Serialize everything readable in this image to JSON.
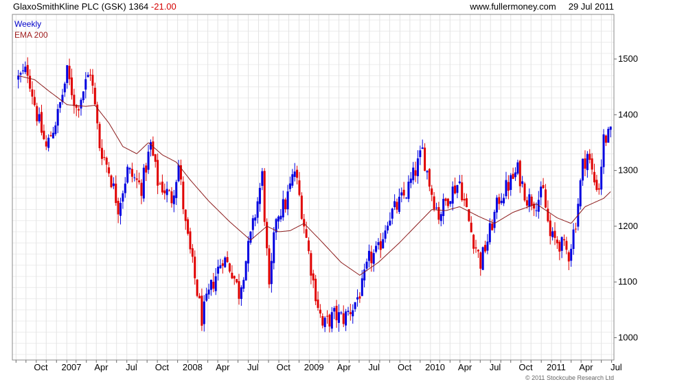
{
  "header": {
    "title": "GlaxoSmithKline PLC (GSK)",
    "last_price": "1364",
    "change": "-21.00",
    "website": "www.fullermoney.com",
    "date": "29 Jul 2011"
  },
  "legend": {
    "primary": "Weekly",
    "overlay": "EMA 200"
  },
  "footer": {
    "copyright": "© 2011 Stockcube Research Ltd"
  },
  "colors": {
    "up": "#0000e0",
    "down": "#e00000",
    "ema": "#8b1a1a",
    "grid": "#d9d9d9"
  },
  "chart_data": {
    "type": "candlestick",
    "interval": "weekly",
    "y_axis": {
      "position": "right",
      "ylim": [
        960,
        1580
      ],
      "ticks": [
        1000,
        1100,
        1200,
        1300,
        1400,
        1500
      ]
    },
    "x_axis": {
      "tick_labels": [
        "Oct",
        "2007",
        "Apr",
        "Jul",
        "Oct",
        "2008",
        "Apr",
        "Jul",
        "Oct",
        "2009",
        "Apr",
        "Jul",
        "Oct",
        "2010",
        "Apr",
        "Jul",
        "Oct",
        "2011",
        "Apr",
        "Jul"
      ]
    },
    "grid": true,
    "price_path": [
      [
        "2006-09-08",
        1465
      ],
      [
        "2006-10-06",
        1480
      ],
      [
        "2006-11-03",
        1400
      ],
      [
        "2006-12-01",
        1340
      ],
      [
        "2007-01-05",
        1400
      ],
      [
        "2007-02-02",
        1475
      ],
      [
        "2007-03-02",
        1410
      ],
      [
        "2007-04-13",
        1480
      ],
      [
        "2007-05-11",
        1345
      ],
      [
        "2007-06-08",
        1300
      ],
      [
        "2007-07-06",
        1235
      ],
      [
        "2007-08-03",
        1300
      ],
      [
        "2007-09-14",
        1270
      ],
      [
        "2007-10-12",
        1345
      ],
      [
        "2007-11-02",
        1280
      ],
      [
        "2007-12-14",
        1250
      ],
      [
        "2008-01-04",
        1310
      ],
      [
        "2008-01-25",
        1200
      ],
      [
        "2008-03-14",
        1035
      ],
      [
        "2008-04-11",
        1090
      ],
      [
        "2008-05-16",
        1145
      ],
      [
        "2008-06-13",
        1120
      ],
      [
        "2008-07-04",
        1080
      ],
      [
        "2008-08-15",
        1200
      ],
      [
        "2008-09-12",
        1290
      ],
      [
        "2008-10-03",
        1080
      ],
      [
        "2008-10-24",
        1220
      ],
      [
        "2008-11-21",
        1240
      ],
      [
        "2008-12-19",
        1300
      ],
      [
        "2009-01-09",
        1230
      ],
      [
        "2009-02-13",
        1100
      ],
      [
        "2009-03-13",
        1020
      ],
      [
        "2009-04-17",
        1040
      ],
      [
        "2009-05-15",
        1035
      ],
      [
        "2009-06-12",
        1055
      ],
      [
        "2009-07-10",
        1090
      ],
      [
        "2009-07-31",
        1140
      ],
      [
        "2009-08-28",
        1155
      ],
      [
        "2009-09-25",
        1215
      ],
      [
        "2009-10-23",
        1235
      ],
      [
        "2009-11-20",
        1260
      ],
      [
        "2009-12-18",
        1300
      ],
      [
        "2010-01-08",
        1335
      ],
      [
        "2010-02-05",
        1260
      ],
      [
        "2010-02-26",
        1220
      ],
      [
        "2010-04-02",
        1260
      ],
      [
        "2010-04-30",
        1280
      ],
      [
        "2010-06-04",
        1190
      ],
      [
        "2010-07-02",
        1135
      ],
      [
        "2010-07-23",
        1175
      ],
      [
        "2010-08-27",
        1250
      ],
      [
        "2010-10-01",
        1280
      ],
      [
        "2010-10-22",
        1300
      ],
      [
        "2010-11-19",
        1250
      ],
      [
        "2010-12-17",
        1245
      ],
      [
        "2011-01-07",
        1260
      ],
      [
        "2011-01-28",
        1180
      ],
      [
        "2011-02-25",
        1170
      ],
      [
        "2011-03-25",
        1150
      ],
      [
        "2011-04-15",
        1210
      ],
      [
        "2011-05-06",
        1310
      ],
      [
        "2011-05-20",
        1330
      ],
      [
        "2011-06-10",
        1280
      ],
      [
        "2011-06-24",
        1270
      ],
      [
        "2011-07-08",
        1355
      ],
      [
        "2011-07-29",
        1364
      ]
    ],
    "ema_200_path": [
      [
        "2006-09-08",
        1470
      ],
      [
        "2006-10-27",
        1463
      ],
      [
        "2006-12-08",
        1443
      ],
      [
        "2007-02-02",
        1418
      ],
      [
        "2007-03-30",
        1415
      ],
      [
        "2007-04-27",
        1417
      ],
      [
        "2007-06-08",
        1385
      ],
      [
        "2007-07-20",
        1343
      ],
      [
        "2007-08-31",
        1330
      ],
      [
        "2007-10-05",
        1350
      ],
      [
        "2007-11-16",
        1328
      ],
      [
        "2007-12-28",
        1315
      ],
      [
        "2008-02-08",
        1283
      ],
      [
        "2008-04-04",
        1245
      ],
      [
        "2008-06-06",
        1208
      ],
      [
        "2008-08-08",
        1175
      ],
      [
        "2008-09-26",
        1200
      ],
      [
        "2008-10-31",
        1190
      ],
      [
        "2008-12-05",
        1192
      ],
      [
        "2009-01-16",
        1205
      ],
      [
        "2009-03-06",
        1175
      ],
      [
        "2009-05-08",
        1135
      ],
      [
        "2009-07-03",
        1112
      ],
      [
        "2009-08-28",
        1135
      ],
      [
        "2009-10-30",
        1170
      ],
      [
        "2009-12-18",
        1200
      ],
      [
        "2010-02-05",
        1230
      ],
      [
        "2010-03-19",
        1228
      ],
      [
        "2010-04-30",
        1235
      ],
      [
        "2010-06-25",
        1218
      ],
      [
        "2010-08-13",
        1205
      ],
      [
        "2010-10-08",
        1225
      ],
      [
        "2010-12-17",
        1240
      ],
      [
        "2011-02-18",
        1215
      ],
      [
        "2011-04-01",
        1205
      ],
      [
        "2011-05-13",
        1235
      ],
      [
        "2011-07-08",
        1250
      ],
      [
        "2011-07-29",
        1262
      ]
    ]
  }
}
